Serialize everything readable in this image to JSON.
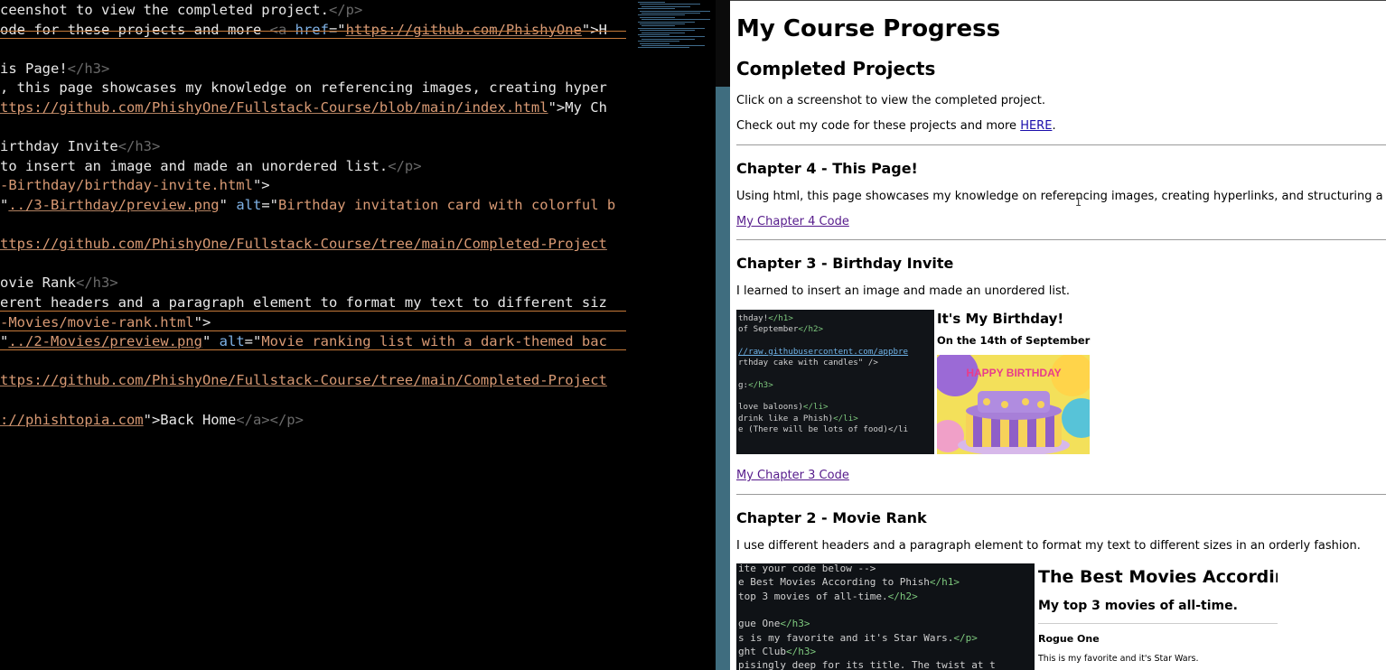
{
  "editor": {
    "lines": [
      {
        "segments": [
          {
            "t": "ceenshot to view the completed project.",
            "c": "plain"
          },
          {
            "t": "</p>",
            "c": "tag"
          }
        ]
      },
      {
        "segments": [
          {
            "t": "ode for these projects and more ",
            "c": "plain"
          },
          {
            "t": "<a ",
            "c": "tag"
          },
          {
            "t": "href",
            "c": "attr"
          },
          {
            "t": "=\"",
            "c": "plain"
          },
          {
            "t": "https://github.com/PhishyOne",
            "c": "str"
          },
          {
            "t": "\">H",
            "c": "plain"
          }
        ]
      },
      {
        "segments": []
      },
      {
        "segments": [
          {
            "t": "is Page!",
            "c": "plain"
          },
          {
            "t": "</h3>",
            "c": "tag"
          }
        ]
      },
      {
        "segments": [
          {
            "t": ", this page showcases my knowledge on referencing images, creating hyper",
            "c": "plain"
          }
        ]
      },
      {
        "segments": [
          {
            "t": "ttps://github.com/PhishyOne/Fullstack-Course/blob/main/index.html",
            "c": "str"
          },
          {
            "t": "\">My Ch",
            "c": "plain"
          }
        ]
      },
      {
        "segments": []
      },
      {
        "segments": [
          {
            "t": "irthday Invite",
            "c": "plain"
          },
          {
            "t": "</h3>",
            "c": "tag"
          }
        ]
      },
      {
        "segments": [
          {
            "t": "to insert an image and made an unordered list.",
            "c": "plain"
          },
          {
            "t": "</p>",
            "c": "tag"
          }
        ]
      },
      {
        "segments": [
          {
            "t": "-Birthday/birthday-invite.html",
            "c": "plain-str"
          },
          {
            "t": "\">",
            "c": "plain"
          }
        ]
      },
      {
        "segments": [
          {
            "t": "\"",
            "c": "plain"
          },
          {
            "t": "../3-Birthday/preview.png",
            "c": "str"
          },
          {
            "t": "\" ",
            "c": "plain"
          },
          {
            "t": "alt",
            "c": "attr"
          },
          {
            "t": "=\"",
            "c": "plain"
          },
          {
            "t": "Birthday invitation card with colorful b",
            "c": "plain-str"
          }
        ]
      },
      {
        "segments": []
      },
      {
        "segments": [
          {
            "t": "ttps://github.com/PhishyOne/Fullstack-Course/tree/main/Completed-Project",
            "c": "str"
          }
        ]
      },
      {
        "segments": []
      },
      {
        "segments": [
          {
            "t": "ovie Rank",
            "c": "plain"
          },
          {
            "t": "</h3>",
            "c": "tag"
          }
        ]
      },
      {
        "segments": [
          {
            "t": "erent headers and a paragraph element to format my text to different siz",
            "c": "plain"
          }
        ]
      },
      {
        "segments": [
          {
            "t": "-Movies/movie-rank.html",
            "c": "plain-str"
          },
          {
            "t": "\">",
            "c": "plain"
          }
        ]
      },
      {
        "segments": [
          {
            "t": "\"",
            "c": "plain"
          },
          {
            "t": "../2-Movies/preview.png",
            "c": "str"
          },
          {
            "t": "\" ",
            "c": "plain"
          },
          {
            "t": "alt",
            "c": "attr"
          },
          {
            "t": "=\"",
            "c": "plain"
          },
          {
            "t": "Movie ranking list with a dark-themed bac",
            "c": "plain-str"
          }
        ]
      },
      {
        "segments": []
      },
      {
        "segments": [
          {
            "t": "ttps://github.com/PhishyOne/Fullstack-Course/tree/main/Completed-Project",
            "c": "str"
          }
        ]
      },
      {
        "segments": []
      },
      {
        "segments": [
          {
            "t": "://phishtopia.com",
            "c": "str"
          },
          {
            "t": "\">Back Home",
            "c": "plain"
          },
          {
            "t": "</a></p>",
            "c": "tag"
          }
        ]
      }
    ]
  },
  "page": {
    "title": "My Course Progress",
    "subtitle": "Completed Projects",
    "intro": "Click on a screenshot to view the completed project.",
    "code_prefix": "Check out my code for these projects and more ",
    "code_link": "HERE",
    "code_suffix": ".",
    "ch4": {
      "heading": "Chapter 4 - This Page!",
      "desc": "Using html, this page showcases my knowledge on referencing images, creating hyperlinks, and structuring a si",
      "link": "My Chapter 4 Code"
    },
    "ch3": {
      "heading": "Chapter 3 - Birthday Invite",
      "desc": "I learned to insert an image and made an unordered list.",
      "link": "My Chapter 3 Code",
      "preview_title": "It's My Birthday!",
      "preview_sub": "On the 14th of September",
      "cake_text": "HAPPY BIRTHDAY",
      "code_lines": [
        "thday!</h1>",
        "of September</h2>",
        "",
        "//raw.githubusercontent.com/appbre",
        "rthday cake with candles\" />",
        "",
        "g:</h3>",
        "",
        "love baloons)</li>",
        "drink like a Phish)</li>",
        "e (There will be lots of food)</li"
      ]
    },
    "ch2": {
      "heading": "Chapter 2 - Movie Rank",
      "desc": "I use different headers and a paragraph element to format my text to different sizes in an orderly fashion.",
      "preview_title": "The Best Movies Accordin",
      "preview_sub": "My top 3 movies of all-time.",
      "preview_h3": "Rogue One",
      "preview_p": "This is my favorite and it's Star Wars.",
      "code_lines": [
        "ite your code below -->",
        "e Best Movies According to Phish</h1>",
        "top 3 movies of all-time.</h2>",
        "",
        "gue One</h3>",
        "s is my favorite and it's Star Wars.</p>",
        "ght Club</h3>",
        "pisingly deep for its title. The twist at t"
      ]
    }
  }
}
